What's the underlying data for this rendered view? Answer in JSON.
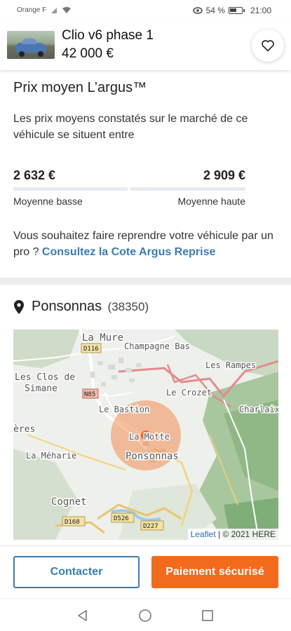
{
  "status_bar": {
    "carrier": "Orange F",
    "battery": "54 %",
    "time": "21:00"
  },
  "header": {
    "title": "Clio v6 phase 1",
    "price": "42 000 €",
    "favorite_icon": "heart-outline-icon"
  },
  "argus": {
    "title": "Prix moyen L’argus™",
    "description": "Les prix moyens constatés sur le marché de ce véhicule se situent entre",
    "low_price": "2 632 €",
    "high_price": "2 909 €",
    "low_label": "Moyenne basse",
    "high_label": "Moyenne haute",
    "reprise_text": "Vous souhaitez faire reprendre votre véhicule par un pro ?",
    "reprise_link": "Consultez la Cote Argus Reprise"
  },
  "location": {
    "icon": "location-pin-icon",
    "city": "Ponsonnas",
    "zip": "(38350)"
  },
  "map": {
    "labels": {
      "la_mure": "La Mure",
      "d116": "D116",
      "champagne_bas": "Champagne Bas",
      "les_rampes": "Les Rampes",
      "les_clos_de": "Les Clos de",
      "simane": "Simane",
      "le_crozet": "Le Crozet",
      "n85": "N85",
      "le_bastion": "Le Bastion",
      "charlaix": "Charlaix",
      "eres": "ères",
      "la_motte": "La Motte",
      "la_meharie": "La Méharie",
      "ponsonnas": "Ponsonnas",
      "cognet": "Cognet",
      "d168": "D168",
      "d526": "D526",
      "d227": "D227"
    },
    "attribution_link": "Leaflet",
    "attribution_text": "| © 2021 HERE",
    "marker_color": "#f26a1c"
  },
  "actions": {
    "contact_label": "Contacter",
    "pay_label": "Paiement sécurisé",
    "primary_color": "#f26a1c",
    "link_color": "#3a7cb2"
  },
  "nav": {
    "back_icon": "back-triangle-icon",
    "home_icon": "home-circle-icon",
    "recents_icon": "recents-square-icon"
  }
}
